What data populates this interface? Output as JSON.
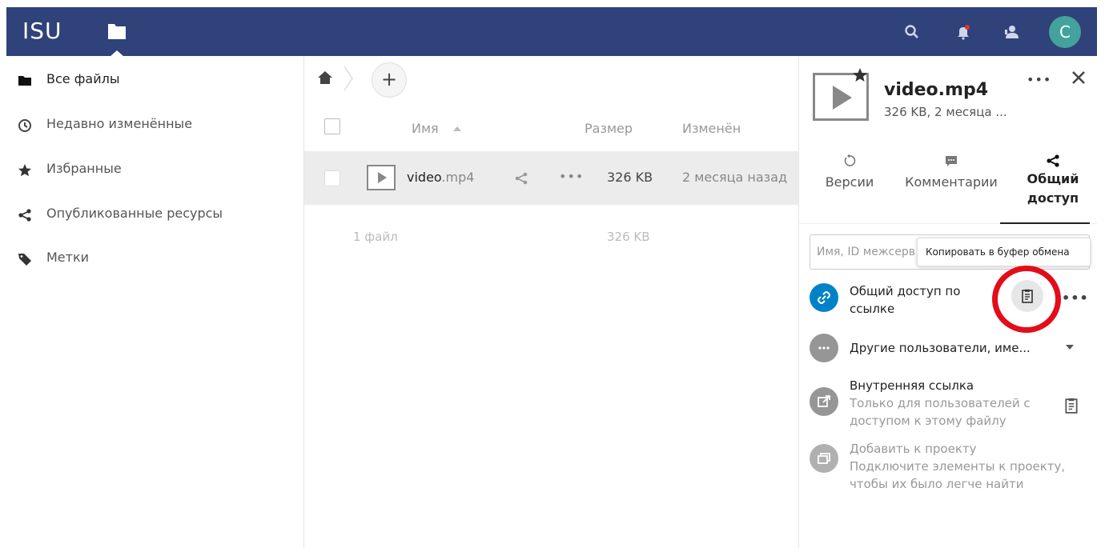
{
  "header": {
    "logo": "ISU",
    "avatar_letter": "C",
    "colors": {
      "bar": "#2f4279",
      "avatar": "#43a29b"
    }
  },
  "sidebar": {
    "items": [
      {
        "label": "Все файлы",
        "icon": "folder-icon",
        "active": true
      },
      {
        "label": "Недавно изменённые",
        "icon": "clock-icon"
      },
      {
        "label": "Избранные",
        "icon": "star-icon"
      },
      {
        "label": "Опубликованные ресурсы",
        "icon": "share-icon"
      },
      {
        "label": "Метки",
        "icon": "tag-icon"
      }
    ]
  },
  "filelist": {
    "add_label": "+",
    "columns": {
      "name": "Имя",
      "size": "Размер",
      "modified": "Изменён"
    },
    "files": [
      {
        "name_base": "video",
        "name_ext": ".mp4",
        "more": "•••",
        "size": "326 KB",
        "modified": "2 месяца назад"
      }
    ],
    "summary": {
      "count": "1 файл",
      "size": "326 KB"
    }
  },
  "panel": {
    "more": "•••",
    "file_title": "video.mp4",
    "file_sub": "326 KB, 2 месяца ...",
    "tabs": [
      {
        "label": "Версии",
        "icon": "history-icon"
      },
      {
        "label": "Комментарии",
        "icon": "comment-icon"
      },
      {
        "label_line1": "Общий",
        "label_line2": "доступ",
        "icon": "share-icon",
        "active": true
      }
    ],
    "share_input_placeholder": "Имя, ID межсерв",
    "tooltip": "Копировать в буфер обмена",
    "link_share": {
      "line1": "Общий доступ по",
      "line2": "ссылке",
      "more": "•••"
    },
    "others": {
      "label": "Другие пользователи, име..."
    },
    "internal": {
      "title": "Внутренняя ссылка",
      "line1": "Только для пользователей с",
      "line2": "доступом к этому файлу"
    },
    "project": {
      "title": "Добавить к проекту",
      "line1": "Подключите элементы к проекту,",
      "line2": "чтобы их было легче найти"
    },
    "colors": {
      "link_circle": "#0082c9",
      "grey_circle": "#969696",
      "highlight": "#e30d1a"
    }
  }
}
